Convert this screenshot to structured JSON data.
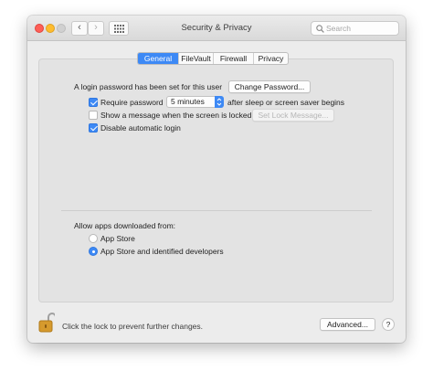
{
  "window": {
    "title": "Security & Privacy"
  },
  "toolbar": {
    "back_glyph": "‹",
    "forward_glyph": "›",
    "search_placeholder": "Search"
  },
  "tabs": [
    {
      "label": "General",
      "active": true
    },
    {
      "label": "FileVault",
      "active": false
    },
    {
      "label": "Firewall",
      "active": false
    },
    {
      "label": "Privacy",
      "active": false
    }
  ],
  "general": {
    "login_password_text": "A login password has been set for this user",
    "change_password_label": "Change Password...",
    "require_password": {
      "label": "Require password",
      "checked": true
    },
    "require_password_delay": "5 minutes",
    "require_password_suffix": "after sleep or screen saver begins",
    "show_message": {
      "label": "Show a message when the screen is locked",
      "checked": false
    },
    "set_lock_message_label": "Set Lock Message...",
    "disable_auto_login": {
      "label": "Disable automatic login",
      "checked": true
    }
  },
  "allow_apps": {
    "heading": "Allow apps downloaded from:",
    "options": [
      {
        "label": "App Store",
        "selected": false
      },
      {
        "label": "App Store and identified developers",
        "selected": true
      }
    ]
  },
  "footer": {
    "lock_text": "Click the lock to prevent further changes.",
    "advanced_label": "Advanced...",
    "help_label": "?"
  },
  "colors": {
    "accent": "#3d89f5",
    "window_bg": "#ececec",
    "panel_bg": "#e3e3e3"
  }
}
